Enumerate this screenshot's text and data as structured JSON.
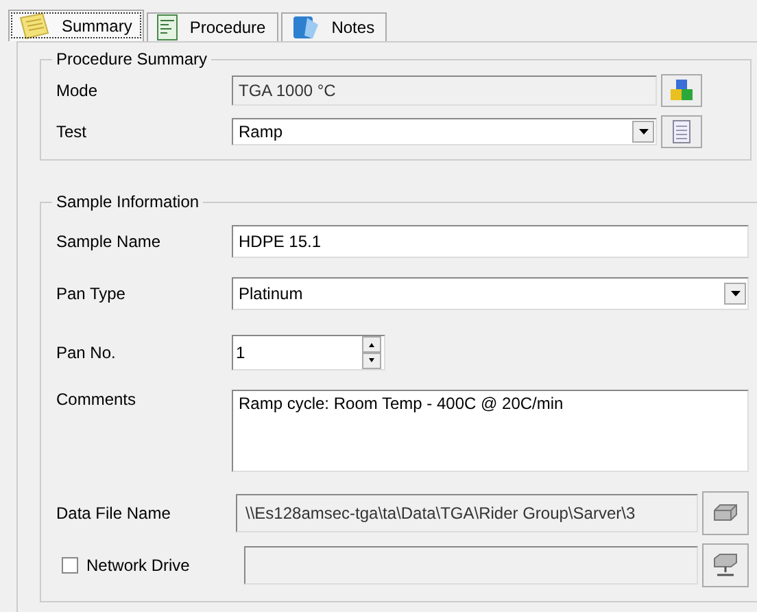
{
  "tabs": [
    {
      "label": "Summary",
      "selected": true,
      "kind": "summary"
    },
    {
      "label": "Procedure",
      "selected": false,
      "kind": "procedure"
    },
    {
      "label": "Notes",
      "selected": false,
      "kind": "notes"
    }
  ],
  "procedure_summary": {
    "title": "Procedure Summary",
    "mode": {
      "label": "Mode",
      "value": "TGA 1000 °C",
      "disabled": true
    },
    "test": {
      "label": "Test",
      "value": "Ramp"
    }
  },
  "sample_information": {
    "title": "Sample Information",
    "sample_name": {
      "label": "Sample Name",
      "value": "HDPE 15.1"
    },
    "pan_type": {
      "label": "Pan Type",
      "value": "Platinum"
    },
    "pan_no": {
      "label": "Pan No.",
      "value": "1"
    },
    "comments": {
      "label": "Comments",
      "value": "Ramp cycle: Room Temp - 400C @ 20C/min"
    },
    "data_file_name": {
      "label": "Data File Name",
      "value": "\\\\Es128amsec-tga\\ta\\Data\\TGA\\Rider Group\\Sarver\\3",
      "disabled": true
    },
    "network_drive": {
      "label": "Network Drive",
      "checked": false
    }
  }
}
